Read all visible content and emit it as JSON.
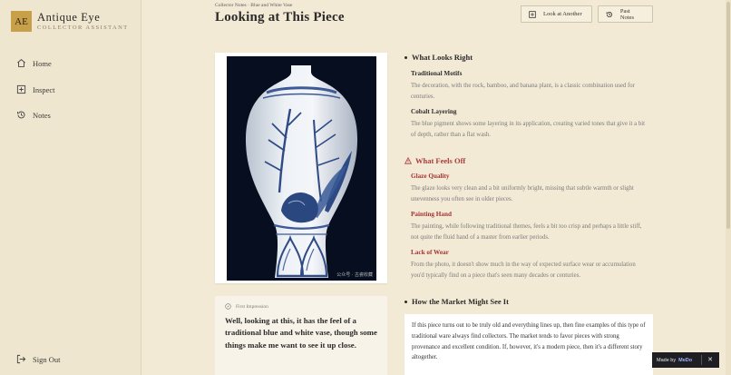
{
  "brand": {
    "logo_text": "AE",
    "title": "Antique Eye",
    "subtitle": "COLLECTOR ASSISTANT"
  },
  "sidebar": {
    "items": [
      {
        "label": "Home",
        "icon": "home-icon"
      },
      {
        "label": "Inspect",
        "icon": "plus-square-icon"
      },
      {
        "label": "Notes",
        "icon": "history-icon"
      }
    ],
    "signout": {
      "label": "Sign Out",
      "icon": "sign-out-icon"
    }
  },
  "header": {
    "breadcrumb": "Collector Notes · Blue and White Vase",
    "title": "Looking at This Piece",
    "look_another_label": "Look at Another",
    "past_notes_label": "Past Notes"
  },
  "photo": {
    "watermark": "公众号 · 古瓷收藏"
  },
  "impression": {
    "label": "First Impression",
    "text": "Well, looking at this, it has the feel of a traditional blue and white vase, though some things make me want to see it up close."
  },
  "looks_right": {
    "heading": "What Looks Right",
    "items": [
      {
        "title": "Traditional Motifs",
        "body": "The decoration, with the rock, bamboo, and banana plant, is a classic combination used for centuries."
      },
      {
        "title": "Cobalt Layering",
        "body": "The blue pigment shows some layering in its application, creating varied tones that give it a bit of depth, rather than a flat wash."
      }
    ]
  },
  "feels_off": {
    "heading": "What Feels Off",
    "items": [
      {
        "title": "Glaze Quality",
        "body": "The glaze looks very clean and a bit uniformly bright, missing that subtle warmth or slight unevenness you often see in older pieces."
      },
      {
        "title": "Painting Hand",
        "body": "The painting, while following traditional themes, feels a bit too crisp and perhaps a little stiff, not quite the fluid hand of a master from earlier periods."
      },
      {
        "title": "Lack of Wear",
        "body": "From the photo, it doesn't show much in the way of expected surface wear or accumulation you'd typically find on a piece that's seen many decades or centuries."
      }
    ]
  },
  "market": {
    "heading": "How the Market Might See It",
    "body": "If this piece turns out to be truly old and everything lines up, then fine examples of this type of traditional ware always find collectors. The market tends to favor pieces with strong provenance and excellent condition. If, however, it's a modern piece, then it's a different story altogether."
  },
  "badge": {
    "prefix": "Made by",
    "name": "MeDo",
    "close": "✕"
  },
  "colors": {
    "accent": "#c9a04a",
    "warning": "#a83a3a",
    "background": "#f3ead6",
    "photo_bg": "#060e1f",
    "cobalt": "#3d5a96"
  }
}
